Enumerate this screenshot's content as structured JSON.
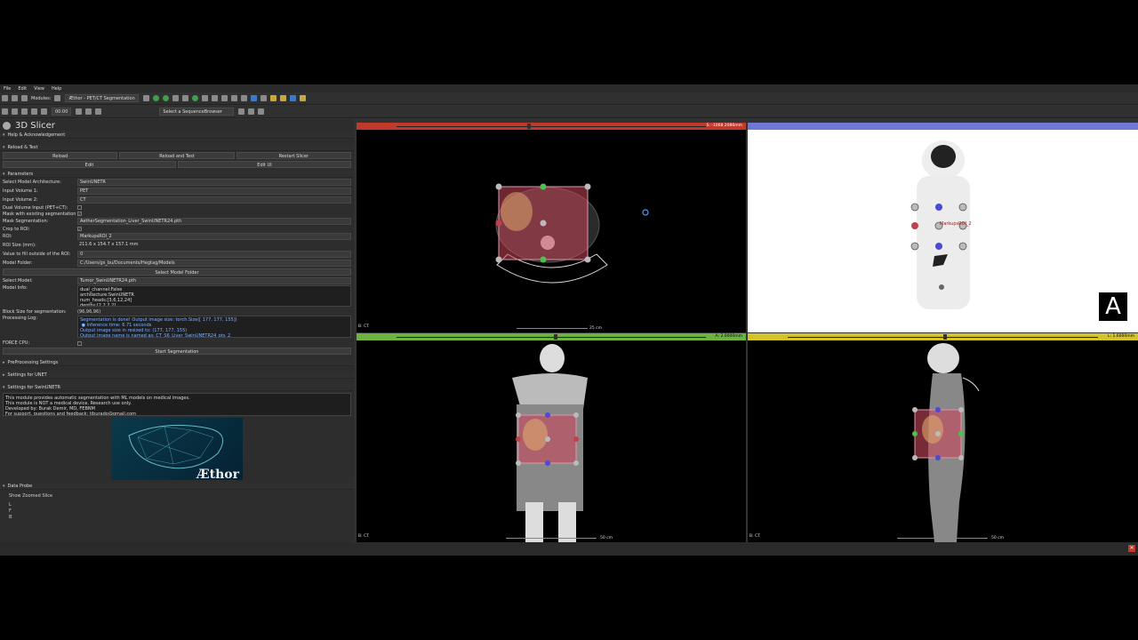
{
  "menu": [
    "File",
    "Edit",
    "View",
    "Help"
  ],
  "toolbar": {
    "modules_label": "Modules:",
    "module_selected": "Æthor - PET/CT Segmentation",
    "sequence_browser": "Select a SequenceBrowser",
    "frame_value": "00:00"
  },
  "app_title": "3D Slicer",
  "sections": {
    "help": "Help & Acknowledgement",
    "reload": "Reload & Test",
    "parameters": "Parameters",
    "preprocessing": "PreProcessing Settings",
    "unet": "Settings for UNET",
    "swin": "Settings for SwinUNETR",
    "data_probe": "Data Probe"
  },
  "reload_buttons": [
    "Reload",
    "Reload and Test",
    "Restart Slicer"
  ],
  "edit_buttons": [
    "Edit",
    "Edit UI"
  ],
  "params": [
    {
      "label": "Select Model Architecture:",
      "value": "SwinUNETR"
    },
    {
      "label": "Input Volume 1:",
      "value": "PET"
    },
    {
      "label": "Input Volume 2:",
      "value": "CT"
    },
    {
      "label": "Dual Volume Input (PET+CT):",
      "value": ""
    },
    {
      "label": "Mask with existing segmentation (pre):",
      "value": "✓"
    },
    {
      "label": "Mask Segmentation:",
      "value": "AetherSegmentation_Liver_SwinUNETR24.pth"
    },
    {
      "label": "Crop to ROI:",
      "value": "✓"
    },
    {
      "label": "ROI:",
      "value": "MarkupsROI_2"
    },
    {
      "label": "ROI Size (mm):",
      "value": "211.6 x 154.7 x 157.1 mm"
    },
    {
      "label": "Value to fill outside of the ROI:",
      "value": "0"
    },
    {
      "label": "Model Folder:",
      "value": "C:/Users/gs_bu/Documents/Hegtag/Models"
    }
  ],
  "select_model_folder_btn": "Select Model Folder",
  "select_model": {
    "label": "Select Model:",
    "value": "Tumor_SwinUNETR24.pth"
  },
  "model_info": {
    "label": "Model Info:",
    "text": "dual_channel:False\narchitecture:SwinUNETR\nnum_heads:[3,6,12,24]\ndepths:[2,2,2,2]"
  },
  "block_size": {
    "label": "Block Size for segmentation:",
    "value": "(96,96,96)"
  },
  "processing_log": {
    "label": "Processing Log:",
    "text": "Segmentation is done! Output image size: torch.Size([ 177, 177, 155])\n ● Inference time: 6.71 seconds\nOutput image size in resized to: (177, 177, 155)\nOutput image name is named as: CT_S6_Liver_SwinUNETR24_pts_2"
  },
  "force_cpu": "FORCE CPU:",
  "start_btn": "Start Segmentation",
  "info_text": "This module provides automatic segmentation with ML models on medical images.\nThis module is NOT a medical device. Research use only.\nDeveloped by: Burak Demir, MD, FEBNM\nFor support, questions and feedback: tiburado@gmail.com",
  "card_text": "Æthor",
  "probe": {
    "show_zoomed": "Show Zoomed Slice",
    "lines": [
      "L",
      "F",
      "B"
    ]
  },
  "views": {
    "red": {
      "readout": "S: -1068.2086mm",
      "label": "B: CT",
      "ruler": "25 cm",
      "color": "#c0392b"
    },
    "blue": {
      "color": "#6f78d6",
      "roi_label": "MarkupsROI_2"
    },
    "green": {
      "readout": "A: 2.0000mm",
      "label": "B: CT",
      "ruler": "50 cm",
      "color": "#6cb33f"
    },
    "yellow": {
      "readout": "L: 1.6000mm",
      "label": "B: CT",
      "ruler": "50 cm",
      "color": "#d4c32a"
    }
  },
  "badge": "A"
}
